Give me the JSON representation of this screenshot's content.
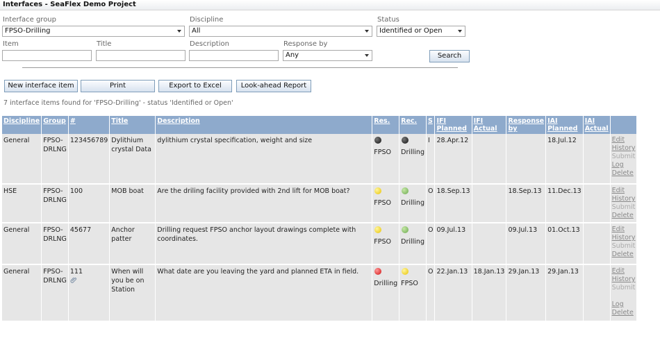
{
  "window": {
    "title": "Interfaces - SeaFlex Demo Project"
  },
  "filters": {
    "interface_group": {
      "label": "Interface group",
      "value": "FPSO-Drilling"
    },
    "discipline": {
      "label": "Discipline",
      "value": "All"
    },
    "status": {
      "label": "Status",
      "value": "Identified or Open"
    },
    "item": {
      "label": "Item",
      "value": ""
    },
    "title": {
      "label": "Title",
      "value": ""
    },
    "description": {
      "label": "Description",
      "value": ""
    },
    "response_by": {
      "label": "Response by",
      "value": "Any"
    },
    "search_label": "Search"
  },
  "toolbar": {
    "new_label": "New interface item",
    "print_label": "Print",
    "export_label": "Export to Excel",
    "lookahead_label": "Look-ahead Report"
  },
  "result_text": "7 interface items found for 'FPSO-Drilling' - status 'Identified or Open'",
  "table": {
    "headers": {
      "discipline": "Discipline",
      "group": "Group",
      "num": "#",
      "title": "Title",
      "description": "Description",
      "res": "Res.",
      "rec": "Rec.",
      "s": "S",
      "ifi_planned": "IFI Planned",
      "ifi_actual": "IFI Actual",
      "response_by": "Response by",
      "iai_planned": "IAI Planned",
      "iai_actual": "IAI Actual"
    },
    "actions": {
      "edit": "Edit",
      "history": "History",
      "submit": "Submit",
      "log": "Log",
      "delete": "Delete"
    },
    "rows": [
      {
        "discipline": "General",
        "group": "FPSO-DRLNG",
        "num": "123456789",
        "title": "Dylithium crystal Data",
        "description": "dylithium crystal specification, weight and size",
        "res_status": "black",
        "res": "FPSO",
        "rec_status": "black",
        "rec": "Drilling",
        "s": "I",
        "ifi_planned": "28.Apr.12",
        "ifi_actual": "",
        "response_by": "",
        "iai_planned": "18.Jul.12",
        "iai_actual": ""
      },
      {
        "discipline": "HSE",
        "group": "FPSO-DRLNG",
        "num": "100",
        "title": "MOB boat",
        "description": "Are the driling facility provided with 2nd lift for MOB boat?",
        "res_status": "yellow",
        "res": "FPSO",
        "rec_status": "green",
        "rec": "Drilling",
        "s": "O",
        "ifi_planned": "18.Sep.13",
        "ifi_actual": "",
        "response_by": "18.Sep.13",
        "iai_planned": "11.Dec.13",
        "iai_actual": ""
      },
      {
        "discipline": "General",
        "group": "FPSO-DRLNG",
        "num": "45677",
        "title": "Anchor patter",
        "description": "Drilling request FPSO anchor layout drawings complete with coordinates.",
        "res_status": "yellow",
        "res": "FPSO",
        "rec_status": "green",
        "rec": "Drilling",
        "s": "O",
        "ifi_planned": "09.Jul.13",
        "ifi_actual": "",
        "response_by": "09.Jul.13",
        "iai_planned": "01.Oct.13",
        "iai_actual": ""
      },
      {
        "discipline": "General",
        "group": "FPSO-DRLNG",
        "num": "111",
        "title": "When will you be on Station",
        "description": "What date are you leaving the yard and planned ETA in field.",
        "res_status": "red",
        "res": "Drilling",
        "rec_status": "yellow",
        "rec": "FPSO",
        "s": "O",
        "ifi_planned": "22.Jan.13",
        "ifi_actual": "18.Jan.13",
        "response_by": "29.Jan.13",
        "iai_planned": "29.Jan.13",
        "iai_actual": ""
      }
    ]
  }
}
